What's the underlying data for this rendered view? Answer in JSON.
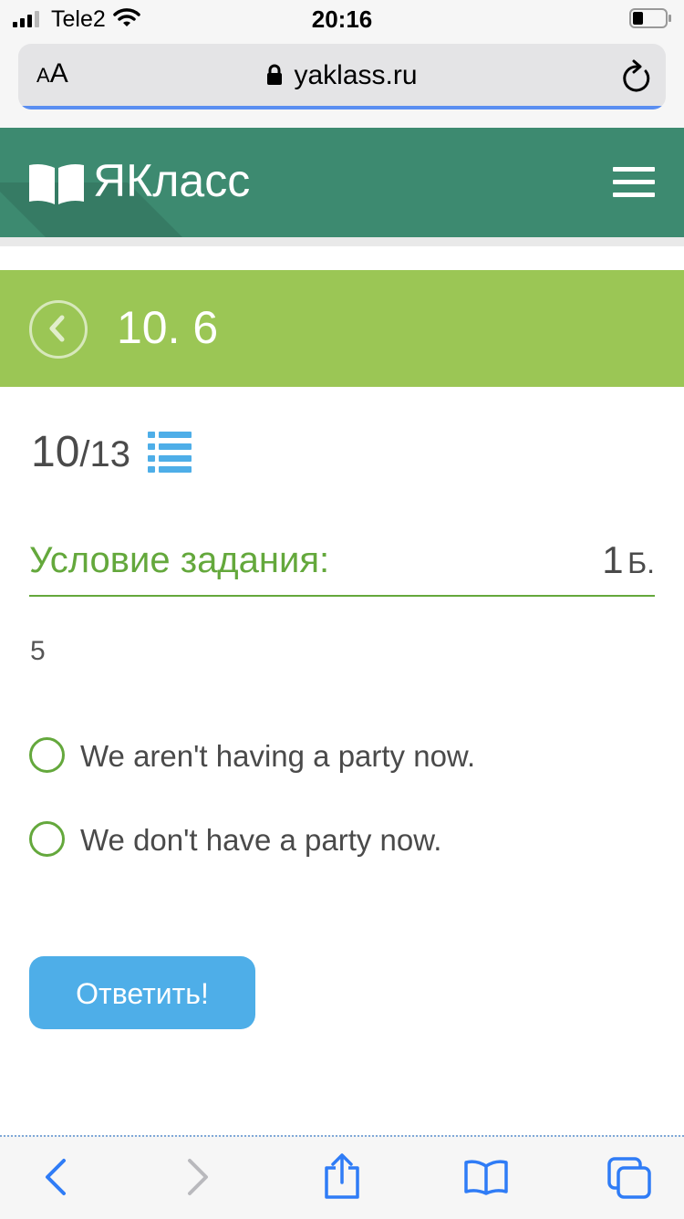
{
  "status_bar": {
    "carrier": "Tele2",
    "time": "20:16"
  },
  "browser": {
    "text_size_label_small": "A",
    "text_size_label_large": "A",
    "url": "yaklass.ru",
    "load_progress": 1.0
  },
  "site": {
    "logo_text": "ЯКласс"
  },
  "topic": {
    "title": "10. 6"
  },
  "exercise": {
    "current": "10",
    "total": "/13",
    "condition_label": "Условие задания:",
    "points_value": "1",
    "points_unit": "Б.",
    "question_text": "5",
    "options": [
      {
        "label": "We aren't having a party now."
      },
      {
        "label": "We don't have a party now."
      }
    ],
    "submit_label": "Ответить!"
  },
  "colors": {
    "header_green": "#3d8a70",
    "banner_green": "#9bc655",
    "accent_green": "#64a83c",
    "button_blue": "#4eaee8",
    "browser_blue": "#2f7cf6"
  }
}
